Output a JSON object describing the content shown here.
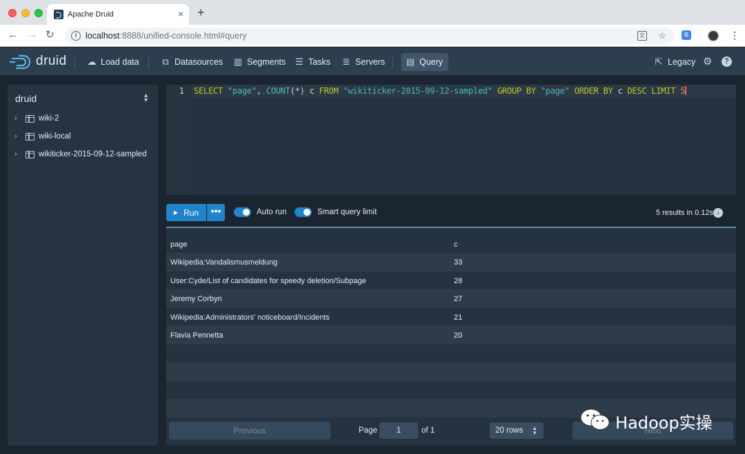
{
  "browser": {
    "tab_title": "Apache Druid",
    "url_host": "localhost",
    "url_rest": ":8888/unified-console.html#query"
  },
  "nav": {
    "logo_text": "druid",
    "items": [
      {
        "label": "Load data",
        "icon": "cloud-upload-icon"
      },
      {
        "label": "Datasources",
        "icon": "multi-select-icon"
      },
      {
        "label": "Segments",
        "icon": "stacked-chart-icon"
      },
      {
        "label": "Tasks",
        "icon": "gantt-chart-icon"
      },
      {
        "label": "Servers",
        "icon": "database-icon"
      },
      {
        "label": "Query",
        "icon": "application-icon"
      }
    ],
    "legacy_label": "Legacy"
  },
  "sidebar": {
    "title": "druid",
    "items": [
      {
        "label": "wiki-2"
      },
      {
        "label": "wiki-local"
      },
      {
        "label": "wikiticker-2015-09-12-sampled"
      }
    ]
  },
  "editor": {
    "line_number": "1",
    "query": "SELECT \"page\", COUNT(*) c FROM \"wikiticker-2015-09-12-sampled\" GROUP BY \"page\" ORDER BY c DESC LIMIT 5"
  },
  "controls": {
    "run_label": "Run",
    "more_label": "•••",
    "auto_run_label": "Auto run",
    "smart_limit_label": "Smart query limit",
    "results_info": "5 results in 0.12s"
  },
  "results": {
    "columns": [
      "page",
      "c"
    ],
    "rows": [
      [
        "Wikipedia:Vandalismusmeldung",
        "33"
      ],
      [
        "User:Cyde/List of candidates for speedy deletion/Subpage",
        "28"
      ],
      [
        "Jeremy Corbyn",
        "27"
      ],
      [
        "Wikipedia:Administrators' noticeboard/Incidents",
        "21"
      ],
      [
        "Flavia Pennetta",
        "20"
      ]
    ]
  },
  "pagination": {
    "previous_label": "Previous",
    "next_label": "Next",
    "page_label": "Page",
    "page_value": "1",
    "of_label": "of 1",
    "rows_label": "20 rows"
  },
  "watermark": {
    "text": "Hadoop实操"
  }
}
